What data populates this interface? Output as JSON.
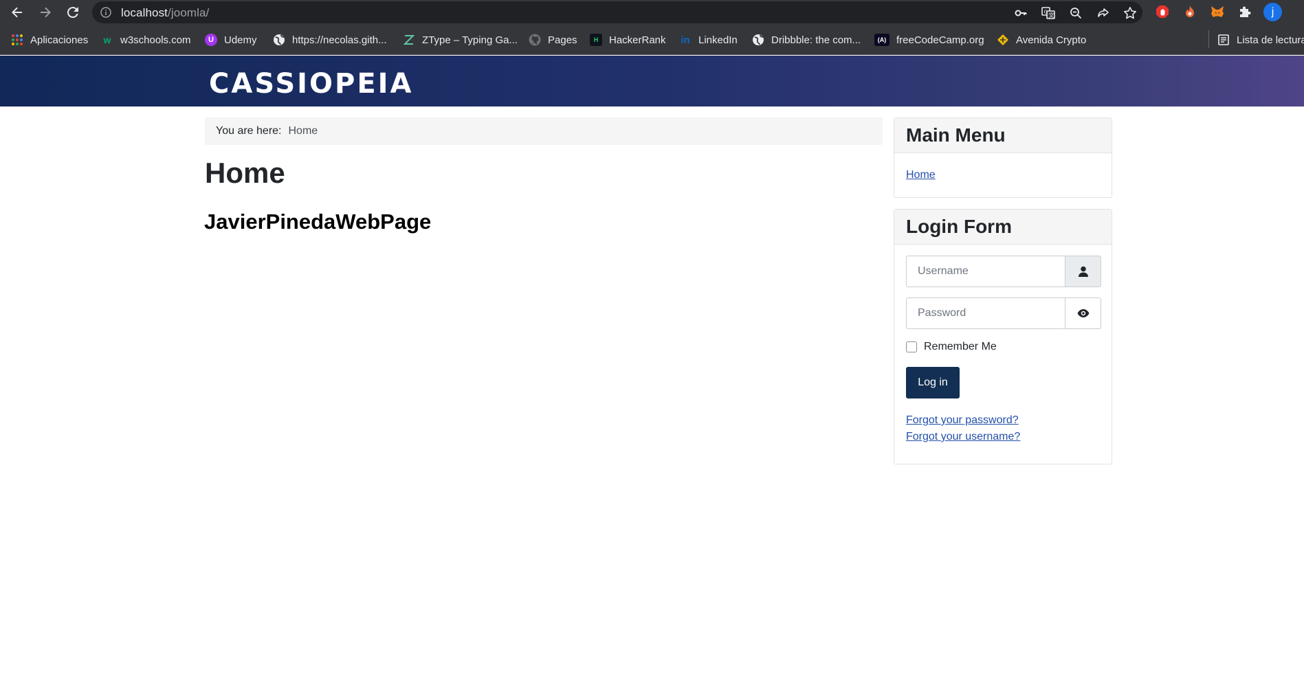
{
  "browser": {
    "url_host": "localhost",
    "url_path": "/joomla/",
    "profile_initial": "j",
    "extensions": [
      "key-icon",
      "translate-icon",
      "zoom-icon",
      "share-icon",
      "star-icon",
      "adblock-icon",
      "extension-flame-icon",
      "metamask-icon",
      "puzzle-icon"
    ]
  },
  "bookmarks": [
    {
      "label": "Aplicaciones",
      "icon": "apps-grid-icon"
    },
    {
      "label": "w3schools.com",
      "icon": "w3schools-icon"
    },
    {
      "label": "Udemy",
      "icon": "udemy-icon"
    },
    {
      "label": "https://necolas.gith...",
      "icon": "globe-icon"
    },
    {
      "label": "ZType – Typing Ga...",
      "icon": "ztype-icon"
    },
    {
      "label": "Pages",
      "icon": "github-icon"
    },
    {
      "label": "HackerRank",
      "icon": "hackerrank-icon"
    },
    {
      "label": "LinkedIn",
      "icon": "linkedin-icon"
    },
    {
      "label": "Dribbble: the com...",
      "icon": "globe-icon"
    },
    {
      "label": "freeCodeCamp.org",
      "icon": "freecodecamp-icon"
    },
    {
      "label": "Avenida Crypto",
      "icon": "crypto-icon"
    }
  ],
  "reading_list": "Lista de lectura",
  "site": {
    "brand": "CASSIOPEIA"
  },
  "breadcrumb": {
    "prefix": "You are here:",
    "current": "Home"
  },
  "page": {
    "title": "Home",
    "article_heading": "JavierPinedaWebPage"
  },
  "main_menu": {
    "title": "Main Menu",
    "items": [
      "Home"
    ]
  },
  "login_form": {
    "title": "Login Form",
    "username_placeholder": "Username",
    "password_placeholder": "Password",
    "remember_label": "Remember Me",
    "submit_label": "Log in",
    "forgot_password": "Forgot your password?",
    "forgot_username": "Forgot your username?"
  },
  "colors": {
    "header_gradient_start": "#112859",
    "header_gradient_end": "#4e4487",
    "primary_button": "#132f53",
    "link": "#224faa"
  }
}
